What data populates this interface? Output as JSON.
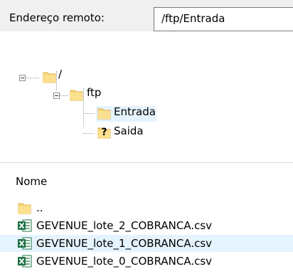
{
  "address_bar": {
    "label": "Endereço remoto:",
    "path": "/ftp/Entrada"
  },
  "tree": {
    "nodes": [
      {
        "label": "/",
        "icon": "folder-icon",
        "expanded": true
      },
      {
        "label": "ftp",
        "icon": "folder-icon",
        "expanded": true
      },
      {
        "label": "Entrada",
        "icon": "folder-icon",
        "selected": true
      },
      {
        "label": "Saida",
        "icon": "folder-unknown-icon",
        "badge": "?"
      }
    ]
  },
  "file_list": {
    "column_header": "Nome",
    "rows": [
      {
        "name": "..",
        "icon": "folder-icon"
      },
      {
        "name": "GEVENUE_lote_2_COBRANCA.csv",
        "icon": "excel-csv-icon"
      },
      {
        "name": "GEVENUE_lote_1_COBRANCA.csv",
        "icon": "excel-csv-icon",
        "selected": true
      },
      {
        "name": "GEVENUE_lote_0_COBRANCA.csv",
        "icon": "excel-csv-icon"
      }
    ]
  },
  "colors": {
    "folder_fill": "#f8d876",
    "folder_edge": "#e0b24a",
    "selection": "#e5f3ff",
    "excel_green": "#1e7145"
  }
}
